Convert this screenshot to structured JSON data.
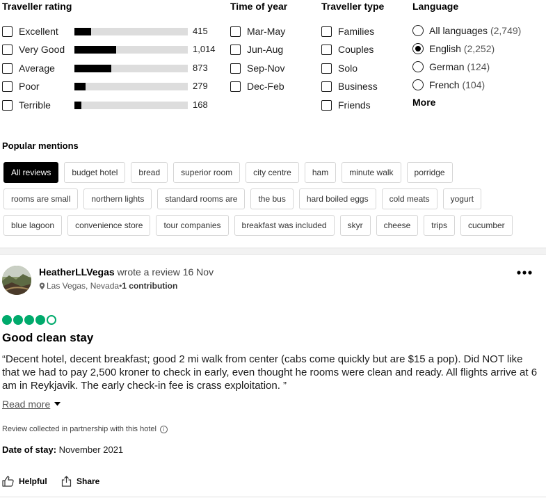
{
  "filters": {
    "rating": {
      "title": "Traveller rating",
      "items": [
        {
          "label": "Excellent",
          "count": "415",
          "fraction": 0.145
        },
        {
          "label": "Very Good",
          "count": "1,014",
          "fraction": 0.37
        },
        {
          "label": "Average",
          "count": "873",
          "fraction": 0.325
        },
        {
          "label": "Poor",
          "count": "279",
          "fraction": 0.1
        },
        {
          "label": "Terrible",
          "count": "168",
          "fraction": 0.06
        }
      ]
    },
    "time": {
      "title": "Time of year",
      "items": [
        "Mar-May",
        "Jun-Aug",
        "Sep-Nov",
        "Dec-Feb"
      ]
    },
    "type": {
      "title": "Traveller type",
      "items": [
        "Families",
        "Couples",
        "Solo",
        "Business",
        "Friends"
      ]
    },
    "language": {
      "title": "Language",
      "items": [
        {
          "label": "All languages",
          "count": "(2,749)",
          "selected": false
        },
        {
          "label": "English",
          "count": "(2,252)",
          "selected": true
        },
        {
          "label": "German",
          "count": "(124)",
          "selected": false
        },
        {
          "label": "French",
          "count": "(104)",
          "selected": false
        }
      ],
      "more": "More"
    }
  },
  "mentions": {
    "title": "Popular mentions",
    "rows": [
      [
        "All reviews",
        "budget hotel",
        "bread",
        "superior room",
        "city centre",
        "ham",
        "minute walk",
        "porridge"
      ],
      [
        "rooms are small",
        "northern lights",
        "standard rooms are",
        "the bus",
        "hard boiled eggs",
        "cold meats",
        "yogurt"
      ],
      [
        "blue lagoon",
        "convenience store",
        "tour companies",
        "breakfast was included",
        "skyr",
        "cheese",
        "trips",
        "cucumber"
      ]
    ]
  },
  "review": {
    "username": "HeatherLLVegas",
    "action_text": " wrote a review 16 Nov",
    "location": "Las Vegas, Nevada",
    "separator": " • ",
    "contributions": "1 contribution",
    "rating": 4,
    "rating_max": 5,
    "title": "Good clean stay",
    "body": "“Decent hotel, decent breakfast; good 2 mi walk from center (cabs come quickly but are $15 a pop). Did NOT like that we had to pay 2,500 kroner to check in early, even thought he rooms were clean and ready. All flights arrive at 6 am in Reykjavik. The early check-in fee is crass exploitation. ”",
    "read_more": "Read more",
    "partner_note": "Review collected in partnership with this hotel",
    "stay_label": "Date of stay:",
    "stay_value": "November 2021",
    "helpful": "Helpful",
    "share": "Share"
  },
  "colors": {
    "bubble": "#00aa6c",
    "bar_fill": "#000000",
    "bar_track": "#dddddd"
  },
  "icons": {
    "menu": "more-horizontal-icon",
    "location": "map-pin-icon",
    "info": "info-icon",
    "helpful": "thumbs-up-icon",
    "share": "share-icon"
  }
}
